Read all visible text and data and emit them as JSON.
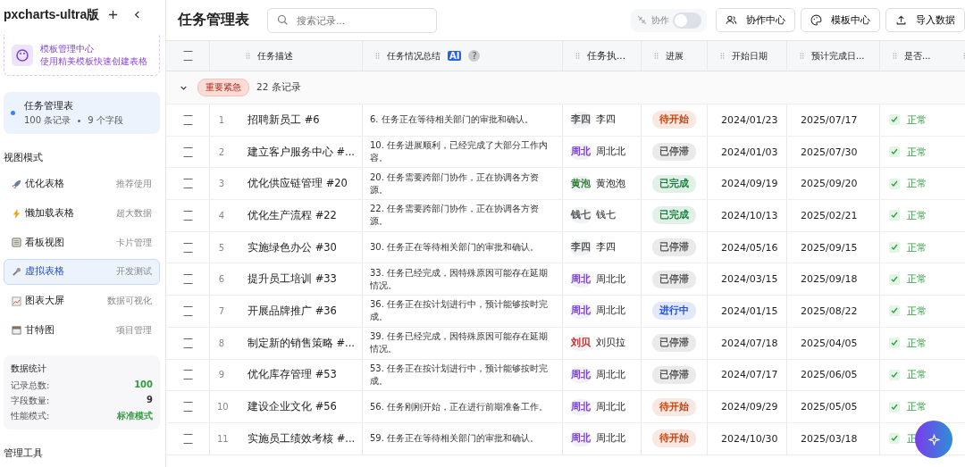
{
  "sidebar": {
    "app_title": "pxcharts-ultra版",
    "template_card": {
      "title": "模板管理中心",
      "subtitle": "使用精美模板快速创建表格"
    },
    "current_table": {
      "name": "任务管理表",
      "records": "100 条记录",
      "fields": "9 个字段"
    },
    "section_title": "视图模式",
    "views": [
      {
        "label": "优化表格",
        "hint": "推荐使用",
        "selected": false
      },
      {
        "label": "懒加载表格",
        "hint": "超大数据",
        "selected": false
      },
      {
        "label": "看板视图",
        "hint": "卡片管理",
        "selected": false
      },
      {
        "label": "虚拟表格",
        "hint": "开发测试",
        "selected": true
      },
      {
        "label": "图表大屏",
        "hint": "数据可视化",
        "selected": false
      },
      {
        "label": "甘特图",
        "hint": "项目管理",
        "selected": false
      }
    ],
    "stats": {
      "title": "数据统计",
      "rows": [
        {
          "label": "记录总数:",
          "value": "100",
          "color": "#2e9d3f"
        },
        {
          "label": "字段数量:",
          "value": "9",
          "color": "#333333"
        },
        {
          "label": "性能模式:",
          "value": "标准模式",
          "color": "#2e9d3f"
        }
      ]
    },
    "section_title_2": "管理工具"
  },
  "header": {
    "title": "任务管理表",
    "search": {
      "placeholder": "搜索记录..."
    },
    "collab_toggle": {
      "label": "协作",
      "on": false
    },
    "buttons": [
      "协作中心",
      "模板中心",
      "导入数据"
    ]
  },
  "table": {
    "header_checked": false,
    "columns": [
      "任务描述",
      "任务情况总结",
      "任务执...",
      "进展",
      "开始日期",
      "预计完成日...",
      "是否..."
    ],
    "ai_badge": "AI",
    "help_mark": "?",
    "group": {
      "tag": "重要紧急",
      "count": "22 条记录",
      "expanded": true
    },
    "rows": [
      {
        "checked": false,
        "no": "1",
        "task": "招聘新员工 #6",
        "summary": "6. 任务正在等待相关部门的审批和确认。",
        "avatar": {
          "text": "李四",
          "color": "#555555"
        },
        "owner": "李四",
        "progress": {
          "label": "待开始",
          "color": "#c2410c"
        },
        "start": "2024/01/23",
        "due": "2025/07/17",
        "health": "正常"
      },
      {
        "checked": false,
        "no": "2",
        "task": "建立客户服务中心 #...",
        "summary": "10. 任务进展顺利，已经完成了大部分工作内容。",
        "avatar": {
          "text": "周北",
          "color": "#7b3fd6"
        },
        "owner": "周北北",
        "progress": {
          "label": "已停滞",
          "color": "#555555"
        },
        "start": "2024/01/03",
        "due": "2025/07/30",
        "health": "正常"
      },
      {
        "checked": false,
        "no": "3",
        "task": "优化供应链管理 #20",
        "summary": "20. 任务需要跨部门协作，正在协调各方资源。",
        "avatar": {
          "text": "黄泡",
          "color": "#2e7d32"
        },
        "owner": "黄泡泡",
        "progress": {
          "label": "已完成",
          "color": "#15803d"
        },
        "start": "2024/09/19",
        "due": "2025/09/20",
        "health": "正常"
      },
      {
        "checked": false,
        "no": "4",
        "task": "优化生产流程 #22",
        "summary": "22. 任务需要跨部门协作，正在协调各方资源。",
        "avatar": {
          "text": "钱七",
          "color": "#555555"
        },
        "owner": "钱七",
        "progress": {
          "label": "已完成",
          "color": "#15803d"
        },
        "start": "2024/10/13",
        "due": "2025/02/21",
        "health": "正常"
      },
      {
        "checked": false,
        "no": "5",
        "task": "实施绿色办公 #30",
        "summary": "30. 任务正在等待相关部门的审批和确认。",
        "avatar": {
          "text": "李四",
          "color": "#555555"
        },
        "owner": "李四",
        "progress": {
          "label": "已停滞",
          "color": "#555555"
        },
        "start": "2024/05/16",
        "due": "2025/09/15",
        "health": "正常"
      },
      {
        "checked": false,
        "no": "6",
        "task": "提升员工培训 #33",
        "summary": "33. 任务已经完成，因特殊原因可能存在延期情况。",
        "avatar": {
          "text": "周北",
          "color": "#7b3fd6"
        },
        "owner": "周北北",
        "progress": {
          "label": "已停滞",
          "color": "#555555"
        },
        "start": "2024/03/15",
        "due": "2025/09/18",
        "health": "正常"
      },
      {
        "checked": false,
        "no": "7",
        "task": "开展品牌推广 #36",
        "summary": "36. 任务正在按计划进行中，预计能够按时完成。",
        "avatar": {
          "text": "周北",
          "color": "#7b3fd6"
        },
        "owner": "周北北",
        "progress": {
          "label": "进行中",
          "color": "#1d4ed8"
        },
        "start": "2024/01/15",
        "due": "2025/08/22",
        "health": "正常"
      },
      {
        "checked": false,
        "no": "8",
        "task": "制定新的销售策略 #...",
        "summary": "39. 任务已经完成，因特殊原因可能存在延期情况。",
        "avatar": {
          "text": "刘贝",
          "color": "#c62828"
        },
        "owner": "刘贝拉",
        "progress": {
          "label": "已停滞",
          "color": "#555555"
        },
        "start": "2024/07/18",
        "due": "2025/04/05",
        "health": "正常"
      },
      {
        "checked": false,
        "no": "9",
        "task": "优化库存管理 #53",
        "summary": "53. 任务正在按计划进行中，预计能够按时完成。",
        "avatar": {
          "text": "周北",
          "color": "#7b3fd6"
        },
        "owner": "周北北",
        "progress": {
          "label": "已停滞",
          "color": "#555555"
        },
        "start": "2024/07/17",
        "due": "2025/06/05",
        "health": "正常"
      },
      {
        "checked": false,
        "no": "10",
        "task": "建设企业文化 #56",
        "summary": "56. 任务刚刚开始，正在进行前期准备工作。",
        "avatar": {
          "text": "周北",
          "color": "#7b3fd6"
        },
        "owner": "周北北",
        "progress": {
          "label": "待开始",
          "color": "#c2410c"
        },
        "start": "2024/09/29",
        "due": "2025/05/05",
        "health": "正常"
      },
      {
        "checked": false,
        "no": "11",
        "task": "实施员工绩效考核 #...",
        "summary": "59. 任务正在等待相关部门的审批和确认。",
        "avatar": {
          "text": "周北",
          "color": "#7b3fd6"
        },
        "owner": "周北北",
        "progress": {
          "label": "待开始",
          "color": "#c2410c"
        },
        "start": "2024/10/30",
        "due": "2025/03/18",
        "health": "正"
      }
    ]
  }
}
